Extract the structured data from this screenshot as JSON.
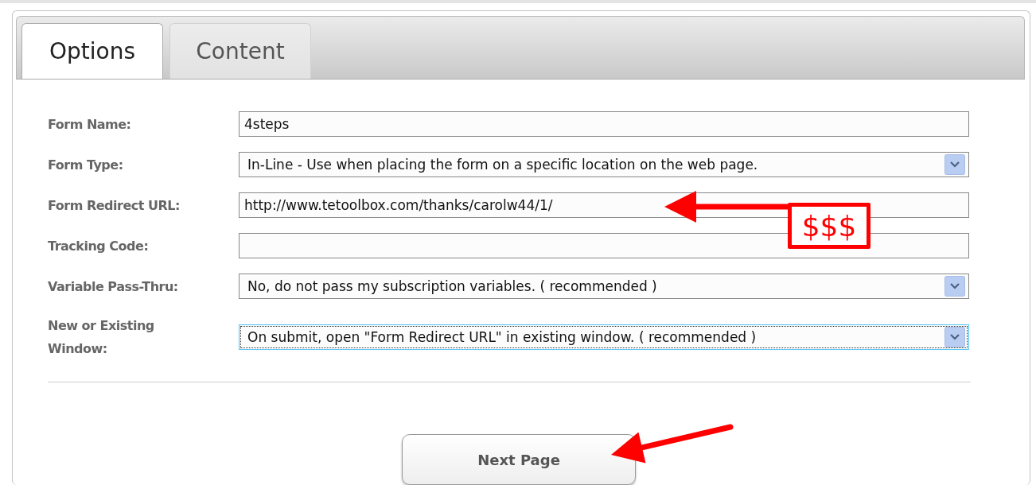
{
  "tabs": [
    {
      "label": "Options",
      "selected": true
    },
    {
      "label": "Content",
      "selected": false
    }
  ],
  "fields": [
    {
      "label": "Form Name:",
      "kind": "text",
      "value": "4steps",
      "focused": false
    },
    {
      "label": "Form Type:",
      "kind": "select",
      "value": "In-Line - Use when placing the form on a specific location on the web page.",
      "focused": false
    },
    {
      "label": "Form Redirect URL:",
      "kind": "text",
      "value": "http://www.tetoolbox.com/thanks/carolw44/1/",
      "focused": false
    },
    {
      "label": "Tracking Code:",
      "kind": "text",
      "focused": false
    },
    {
      "label": "Variable Pass-Thru:",
      "kind": "select",
      "value": "No, do not pass my subscription variables. ( recommended )",
      "focused": false
    },
    {
      "label": "New or Existing Window:",
      "kind": "select",
      "value": "On submit, open \"Form Redirect URL\" in existing window. ( recommended )",
      "focused": true
    }
  ],
  "next_button": {
    "label": "Next Page"
  },
  "annotations": [
    {
      "kind": "arrow"
    },
    {
      "kind": "callout",
      "text": "$$$"
    },
    {
      "kind": "arrow"
    }
  ]
}
